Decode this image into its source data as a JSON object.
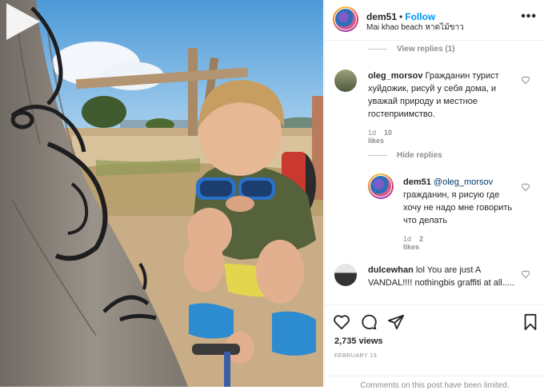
{
  "post": {
    "media": {
      "type": "video",
      "play_icon": "play-icon"
    },
    "header": {
      "username": "dem51",
      "separator": "•",
      "follow_label": "Follow",
      "location": "Mai khao beach หาดไม้ขาว",
      "more_icon": "more-horizontal-icon"
    },
    "comments": {
      "view_replies_label": "View replies (1)",
      "hide_replies_label": "Hide replies",
      "items": [
        {
          "username": "oleg_morsov",
          "text": "Гражданин турист хуйдожик, рисуй у себя дома, и уважай природу и местное гостеприимство.",
          "age": "1d",
          "likes": "10 likes"
        },
        {
          "username": "dem51",
          "mention": "@oleg_morsov",
          "text": "гражданин, я рисую где хочу не надо мне говорить что делать",
          "age": "1d",
          "likes": "2 likes"
        },
        {
          "username": "dulcewhan",
          "text": "lol You are just A VANDAL!!!! nothingbis graffiti at all....."
        }
      ]
    },
    "actions": {
      "like_icon": "heart-icon",
      "comment_icon": "comment-icon",
      "share_icon": "paper-plane-icon",
      "save_icon": "bookmark-icon"
    },
    "views": "2,735 views",
    "date": "FEBRUARY 19",
    "comments_limited": "Comments on this post have been limited."
  }
}
